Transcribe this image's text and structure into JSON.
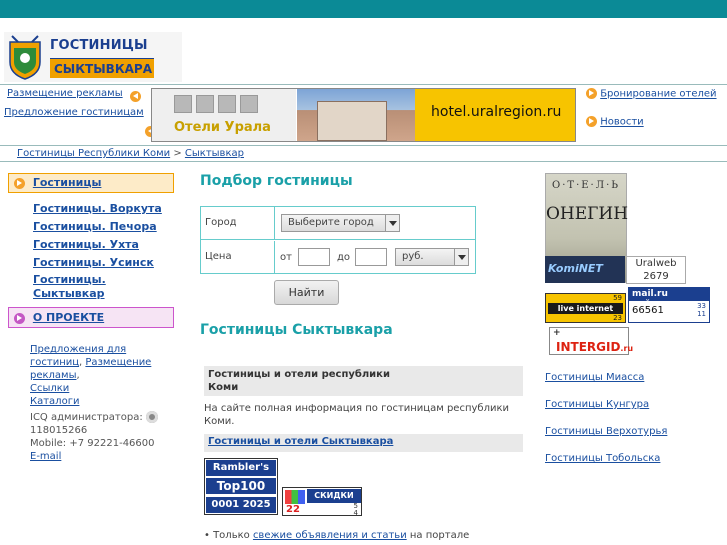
{
  "logo": {
    "line1": "ГОСТИНИЦЫ",
    "line2": "СЫКТЫВКАРА"
  },
  "top_links": {
    "advertising": "Размещение рекламы",
    "offer_hotels": "Предложение гостиницам",
    "booking": "Бронирование отелей",
    "news": "Новости"
  },
  "banner": {
    "title": "Отели Урала",
    "url": "hotel.uralregion.ru"
  },
  "breadcrumb": {
    "root": "Гостиницы Республики Коми",
    "separator": ">",
    "current": "Сыктывкар"
  },
  "left_nav": {
    "hotels": "Гостиницы",
    "cities": [
      "Гостиницы. Воркута",
      "Гостиницы. Печора",
      "Гостиницы. Ухта",
      "Гостиницы. Усинск",
      "Гостиницы. Сыктывкар"
    ],
    "project": "О ПРОЕКТЕ",
    "links": {
      "offers": "Предложения для гостиниц",
      "advertising": "Размещение рекламы",
      "links": "Ссылки",
      "catalogs": "Каталоги"
    },
    "icq_label": "ICQ администратора:",
    "icq_number": "118015266",
    "mobile": "Mobile: +7 92221-46600",
    "email": "E-mail"
  },
  "search": {
    "title": "Подбор гостиницы",
    "city_label": "Город",
    "city_select": "Выберите город",
    "price_label": "Цена",
    "from_label": "от",
    "to_label": "до",
    "currency": "руб.",
    "button": "Найти"
  },
  "hotels": {
    "title": "Гостиницы Сыктывкара",
    "box_head_line1": "Гостиницы и отели республики",
    "box_head_line2": "Коми",
    "box_text": "На сайте полная информация по гостиницам республики Коми.",
    "box_link": "Гостиницы и отели Сыктывкара"
  },
  "counters": {
    "rambler_line1": "Rambler's",
    "rambler_line2": "Top100",
    "rambler_line3": "0001 2025",
    "skidki_label": "СКИДКИ",
    "skidki_num": "22",
    "skidki_small1": "5",
    "skidki_small2": "4",
    "live_top": "59",
    "live_mid": "live internet",
    "live_bottom": "23",
    "mail_title": "mail.ru рейтинг",
    "mail_count": "66561",
    "mail_small1": "33",
    "mail_small2": "11",
    "intergid": "INTERGID",
    "intergid_suffix": ".ru",
    "kominet": "KomiNET",
    "uralweb_name": "Uralweb",
    "uralweb_count": "2679"
  },
  "ads": {
    "onegin_small": "О·Т·Е·Л·Ь",
    "onegin_big": "ОНЕГИН"
  },
  "right_links": [
    "Гостиницы Миасса",
    "Гостиницы Кунгура",
    "Гостиницы Верхотурья",
    "Гостиницы Тобольска"
  ],
  "bottom": {
    "prefix": "• Только",
    "link": "свежие объявления и статьи",
    "suffix": "на портале"
  }
}
